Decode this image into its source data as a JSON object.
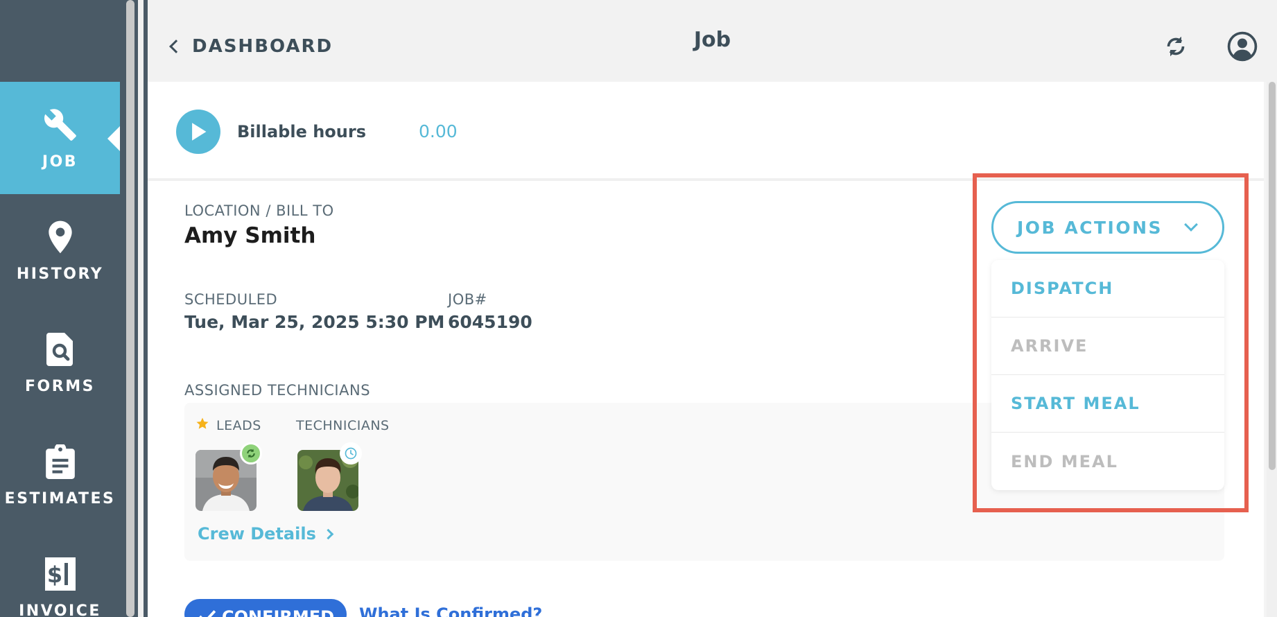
{
  "sidebar": {
    "items": [
      {
        "label": "JOB",
        "icon": "wrench-icon",
        "active": true
      },
      {
        "label": "HISTORY",
        "icon": "map-pin-icon",
        "active": false
      },
      {
        "label": "FORMS",
        "icon": "document-search-icon",
        "active": false
      },
      {
        "label": "ESTIMATES",
        "icon": "clipboard-icon",
        "active": false
      },
      {
        "label": "INVOICE",
        "icon": "invoice-dollar-icon",
        "active": false
      }
    ]
  },
  "header": {
    "back_label": "DASHBOARD",
    "title": "Job",
    "sync_icon": "sync-icon",
    "profile_icon": "user-profile-icon"
  },
  "billable": {
    "label": "Billable hours",
    "value": "0.00"
  },
  "job": {
    "location_label": "LOCATION / BILL TO",
    "location_value": "Amy Smith",
    "scheduled_label": "SCHEDULED",
    "scheduled_value": "Tue, Mar 25, 2025 5:30 PM",
    "jobnum_label": "JOB#",
    "jobnum_value": "6045190"
  },
  "technicians": {
    "section_label": "ASSIGNED TECHNICIANS",
    "leads_label": "LEADS",
    "technicians_label": "TECHNICIANS",
    "crew_link": "Crew Details"
  },
  "status": {
    "confirmed_label": "CONFIRMED",
    "what_link": "What Is Confirmed?"
  },
  "job_actions": {
    "button_label": "JOB ACTIONS",
    "items": [
      {
        "label": "DISPATCH",
        "enabled": true
      },
      {
        "label": "ARRIVE",
        "enabled": false
      },
      {
        "label": "START MEAL",
        "enabled": true
      },
      {
        "label": "END MEAL",
        "enabled": false
      }
    ]
  },
  "colors": {
    "accent": "#56b9d7",
    "sidebar": "#4a5a66",
    "highlight": "#e6604f",
    "confirmed": "#2f6fd8"
  }
}
